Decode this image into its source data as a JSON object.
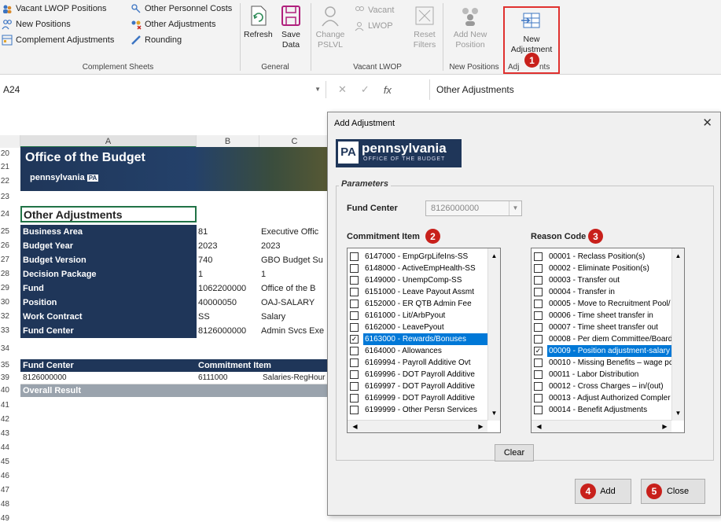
{
  "ribbon": {
    "complement_sheets": {
      "items": [
        "Vacant LWOP Positions",
        "Other Personnel Costs",
        "New Positions",
        "Other Adjustments",
        "Complement Adjustments",
        "Rounding"
      ],
      "group_label": "Complement Sheets"
    },
    "general": {
      "refresh_label": "Refresh",
      "save_label_1": "Save",
      "save_label_2": "Data",
      "group_label": "General"
    },
    "vacant_lwop": {
      "change_label_1": "Change",
      "change_label_2": "PSLVL",
      "vacant_label": "Vacant",
      "lwop_label": "LWOP",
      "reset_label_1": "Reset",
      "reset_label_2": "Filters",
      "group_label": "Vacant LWOP"
    },
    "new_positions": {
      "add_label_1": "Add New",
      "add_label_2": "Position",
      "group_label": "New Positions"
    },
    "adjustments": {
      "new_label_1": "New",
      "new_label_2": "Adjustment",
      "group_label_a": "Adj",
      "group_label_b": "nts"
    }
  },
  "formula_bar": {
    "name_box": "A24",
    "formula": "Other Adjustments"
  },
  "sheet": {
    "col_a": "A",
    "col_b": "B",
    "col_c": "C",
    "banner_title": "Office of the Budget",
    "banner_sub": "pennsylvania",
    "banner_pa": "PA",
    "section_title": "Other Adjustments",
    "rows": [
      {
        "num": "25",
        "key": "Business Area",
        "v1": "81",
        "v2": "Executive Offic"
      },
      {
        "num": "26",
        "key": "Budget Year",
        "v1": "2023",
        "v2": "2023"
      },
      {
        "num": "27",
        "key": "Budget Version",
        "v1": "740",
        "v2": "GBO Budget Su"
      },
      {
        "num": "28",
        "key": "Decision Package",
        "v1": "1",
        "v2": "1"
      },
      {
        "num": "29",
        "key": "Fund",
        "v1": "1062200000",
        "v2": "Office of the B"
      },
      {
        "num": "30",
        "key": "Position",
        "v1": "40000050",
        "v2": "OAJ-SALARY"
      },
      {
        "num": "32",
        "key": "Work Contract",
        "v1": "SS",
        "v2": "Salary"
      },
      {
        "num": "33",
        "key": "Fund Center",
        "v1": "8126000000",
        "v2": "Admin Svcs Exe"
      }
    ],
    "table_header_1": "Fund Center",
    "table_header_2": "Commitment Item",
    "data_row": {
      "c1": "8126000000",
      "c2": "6111000",
      "c3": "Salaries-RegHour"
    },
    "overall": "Overall Result",
    "row_numbers_top": [
      "20",
      "21",
      "22",
      "23",
      "24"
    ],
    "row_numbers_fixed": [
      "34",
      "35",
      "39",
      "40",
      "41",
      "42",
      "43",
      "44",
      "45",
      "46",
      "47",
      "48",
      "49"
    ]
  },
  "dialog": {
    "title": "Add Adjustment",
    "close_glyph": "✕",
    "logo_box": "PA",
    "logo_text": "pennsylvania",
    "logo_sub": "OFFICE OF THE BUDGET",
    "parameters_legend": "Parameters",
    "fund_center_label": "Fund Center",
    "fund_center_value": "8126000000",
    "commitment_label": "Commitment Item",
    "reason_label": "Reason Code",
    "commitment_items": [
      {
        "label": "6147000 - EmpGrpLifeIns-SS",
        "checked": false,
        "selected": false
      },
      {
        "label": "6148000 - ActiveEmpHealth-SS",
        "checked": false,
        "selected": false
      },
      {
        "label": "6149000 - UnempComp-SS",
        "checked": false,
        "selected": false
      },
      {
        "label": "6151000 - Leave Payout Assmt",
        "checked": false,
        "selected": false
      },
      {
        "label": "6152000 - ER QTB Admin Fee",
        "checked": false,
        "selected": false
      },
      {
        "label": "6161000 - Lit/ArbPyout",
        "checked": false,
        "selected": false
      },
      {
        "label": "6162000 - LeavePyout",
        "checked": false,
        "selected": false
      },
      {
        "label": "6163000 - Rewards/Bonuses",
        "checked": true,
        "selected": true
      },
      {
        "label": "6164000 - Allowances",
        "checked": false,
        "selected": false
      },
      {
        "label": "6169994 - Payroll Additive Ovt",
        "checked": false,
        "selected": false
      },
      {
        "label": "6169996 - DOT Payroll Additive",
        "checked": false,
        "selected": false
      },
      {
        "label": "6169997 - DOT Payroll Additive",
        "checked": false,
        "selected": false
      },
      {
        "label": "6169999 - DOT Payroll Additive",
        "checked": false,
        "selected": false
      },
      {
        "label": "6199999 - Other Persn Services",
        "checked": false,
        "selected": false
      }
    ],
    "reason_codes": [
      {
        "label": "00001 - Reclass Position(s)",
        "checked": false,
        "selected": false
      },
      {
        "label": "00002 - Eliminate Position(s)",
        "checked": false,
        "selected": false
      },
      {
        "label": "00003 - Transfer out",
        "checked": false,
        "selected": false
      },
      {
        "label": "00004 - Transfer in",
        "checked": false,
        "selected": false
      },
      {
        "label": "00005 - Move to Recruitment Pool/",
        "checked": false,
        "selected": false
      },
      {
        "label": "00006 - Time sheet transfer in",
        "checked": false,
        "selected": false
      },
      {
        "label": "00007 - Time sheet transfer out",
        "checked": false,
        "selected": false
      },
      {
        "label": "00008 - Per diem Committee/Board",
        "checked": false,
        "selected": false
      },
      {
        "label": "00009 - Position adjustment-salary",
        "checked": true,
        "selected": true
      },
      {
        "label": "00010 - Missing Benefits – wage pc",
        "checked": false,
        "selected": false
      },
      {
        "label": "00011 - Labor Distribution",
        "checked": false,
        "selected": false
      },
      {
        "label": "00012 - Cross Charges – in/(out)",
        "checked": false,
        "selected": false
      },
      {
        "label": "00013 - Adjust Authorized Compler",
        "checked": false,
        "selected": false
      },
      {
        "label": "00014 - Benefit Adjustments",
        "checked": false,
        "selected": false
      }
    ],
    "clear_label": "Clear",
    "add_label": "Add",
    "close_label": "Close"
  },
  "steps": [
    "1",
    "2",
    "3",
    "4",
    "5"
  ],
  "colors": {
    "accent_red": "#c8201b",
    "header_navy": "#1f3659",
    "excel_green": "#217346",
    "selection_blue": "#0078d7"
  }
}
